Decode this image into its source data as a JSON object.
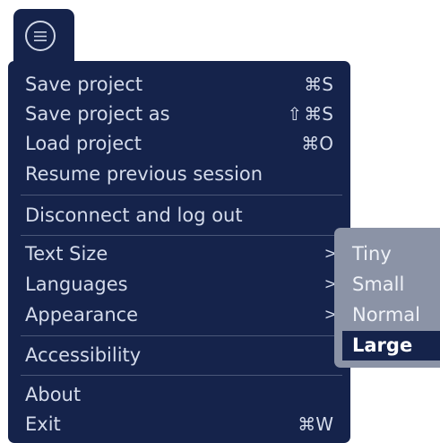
{
  "main_menu": {
    "items": [
      {
        "label": "Save project",
        "shortcut_glyph": "",
        "shortcut": "⌘S"
      },
      {
        "label": "Save project as",
        "shortcut_glyph": "⇧",
        "shortcut": "⌘S"
      },
      {
        "label": "Load project",
        "shortcut_glyph": "",
        "shortcut": "⌘O"
      },
      {
        "label": "Resume previous session"
      },
      {
        "label": "Disconnect and log out"
      },
      {
        "label": "Text Size",
        "arrow": ">"
      },
      {
        "label": "Languages",
        "arrow": ">"
      },
      {
        "label": "Appearance",
        "arrow": ">"
      },
      {
        "label": "Accessibility"
      },
      {
        "label": "About"
      },
      {
        "label": "Exit",
        "shortcut": "⌘W"
      }
    ]
  },
  "submenu_text_size": {
    "options": [
      "Tiny",
      "Small",
      "Normal",
      "Large"
    ],
    "selected": "Large"
  },
  "colors": {
    "menu_bg": "#15234b",
    "menu_text": "#d4dbeb",
    "submenu_bg": "#8b93a6",
    "selected_bg": "#15234b"
  },
  "icons": {
    "menu_button": "hamburger-icon",
    "shift": "shift-icon"
  }
}
